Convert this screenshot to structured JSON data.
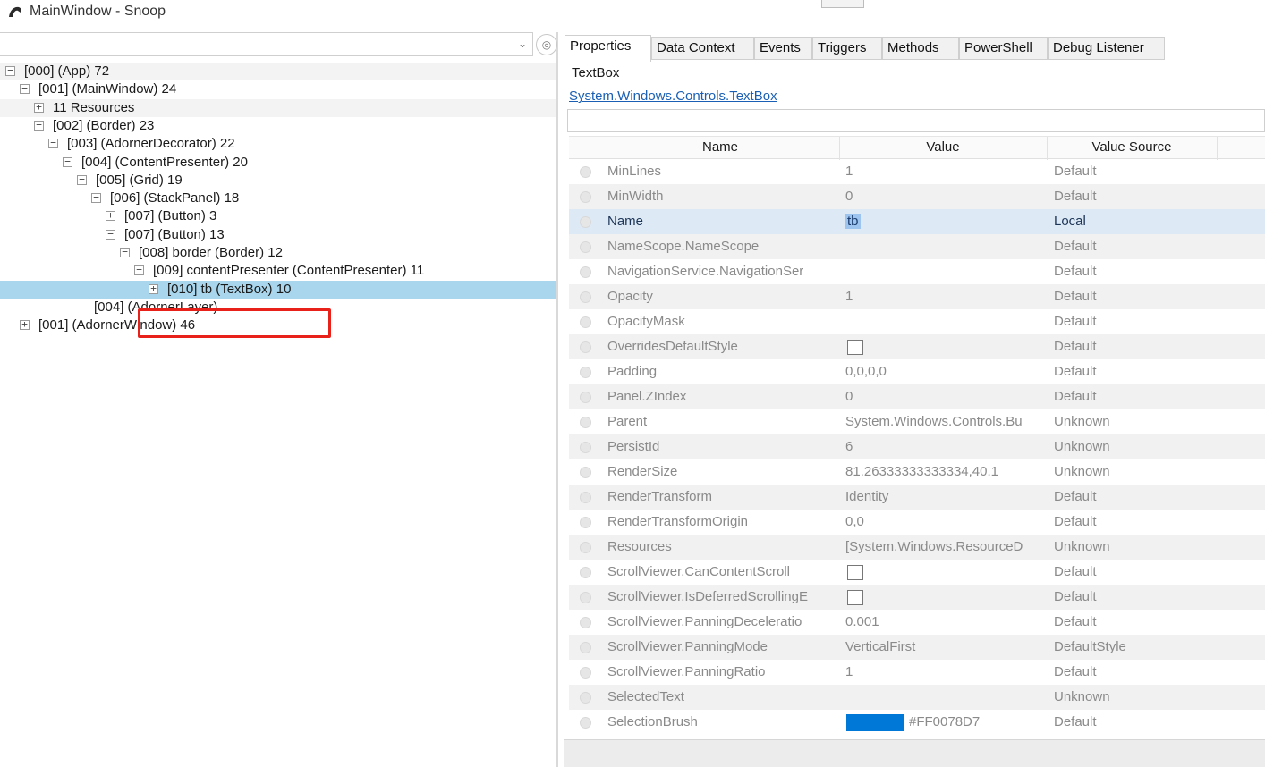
{
  "window": {
    "title": "MainWindow - Snoop"
  },
  "tree": {
    "nodes": [
      {
        "expander": "⊟",
        "label": "[000]  (App) 72"
      },
      {
        "expander": "⊟",
        "label": "[001]  (MainWindow) 24"
      },
      {
        "expander": "⊞",
        "label": "11 Resources"
      },
      {
        "expander": "⊟",
        "label": "[002]  (Border) 23"
      },
      {
        "expander": "⊟",
        "label": "[003]  (AdornerDecorator) 22"
      },
      {
        "expander": "⊟",
        "label": "[004]  (ContentPresenter) 20"
      },
      {
        "expander": "⊟",
        "label": "[005]  (Grid) 19"
      },
      {
        "expander": "⊟",
        "label": "[006]  (StackPanel) 18"
      },
      {
        "expander": "⊞",
        "label": "[007]  (Button) 3"
      },
      {
        "expander": "⊟",
        "label": "[007]  (Button) 13"
      },
      {
        "expander": "⊟",
        "label": "[008] border (Border) 12"
      },
      {
        "expander": "⊟",
        "label": "[009] contentPresenter (ContentPresenter) 11"
      },
      {
        "expander": "⊞",
        "label": "[010] tb (TextBox) 10"
      },
      {
        "expander": "",
        "label": "[004]  (AdornerLayer)"
      },
      {
        "expander": "⊞",
        "label": "[001]  (AdornerWindow) 46"
      }
    ]
  },
  "tabs": [
    "Properties",
    "Data Context",
    "Events",
    "Triggers",
    "Methods",
    "PowerShell",
    "Debug Listener"
  ],
  "inspector": {
    "type_name": "TextBox",
    "type_link": "System.Windows.Controls.TextBox",
    "columns": {
      "name": "Name",
      "value": "Value",
      "source": "Value Source"
    },
    "rows": [
      {
        "name": "MinLines",
        "value": "1",
        "source": "Default"
      },
      {
        "name": "MinWidth",
        "value": "0",
        "source": "Default"
      },
      {
        "name": "Name",
        "value": "tb",
        "source": "Local"
      },
      {
        "name": "NameScope.NameScope",
        "value": "",
        "source": "Default"
      },
      {
        "name": "NavigationService.NavigationSer",
        "value": "",
        "source": "Default"
      },
      {
        "name": "Opacity",
        "value": "1",
        "source": "Default"
      },
      {
        "name": "OpacityMask",
        "value": "",
        "source": "Default"
      },
      {
        "name": "OverridesDefaultStyle",
        "value": "",
        "source": "Default"
      },
      {
        "name": "Padding",
        "value": "0,0,0,0",
        "source": "Default"
      },
      {
        "name": "Panel.ZIndex",
        "value": "0",
        "source": "Default"
      },
      {
        "name": "Parent",
        "value": "System.Windows.Controls.Bu",
        "source": "Unknown"
      },
      {
        "name": "PersistId",
        "value": "6",
        "source": "Unknown"
      },
      {
        "name": "RenderSize",
        "value": "81.26333333333334,40.1",
        "source": "Unknown"
      },
      {
        "name": "RenderTransform",
        "value": "Identity",
        "source": "Default"
      },
      {
        "name": "RenderTransformOrigin",
        "value": "0,0",
        "source": "Default"
      },
      {
        "name": "Resources",
        "value": "[System.Windows.ResourceD",
        "source": "Unknown"
      },
      {
        "name": "ScrollViewer.CanContentScroll",
        "value": "",
        "source": "Default"
      },
      {
        "name": "ScrollViewer.IsDeferredScrollingE",
        "value": "",
        "source": "Default"
      },
      {
        "name": "ScrollViewer.PanningDeceleratio",
        "value": "0.001",
        "source": "Default"
      },
      {
        "name": "ScrollViewer.PanningMode",
        "value": "VerticalFirst",
        "source": "DefaultStyle"
      },
      {
        "name": "ScrollViewer.PanningRatio",
        "value": "1",
        "source": "Default"
      },
      {
        "name": "SelectedText",
        "value": "",
        "source": "Unknown"
      },
      {
        "name": "SelectionBrush",
        "value": "#FF0078D7",
        "source": "Default"
      }
    ]
  },
  "colors": {
    "selection_highlight": "#a9d6ec",
    "annotation_red": "#e8211b",
    "brush_swatch": "#0078d7",
    "link": "#1a5fb4"
  },
  "icons": {
    "app": "snoop-icon",
    "combo_arrow": "chevron-down-icon",
    "find": "find-target-icon"
  }
}
